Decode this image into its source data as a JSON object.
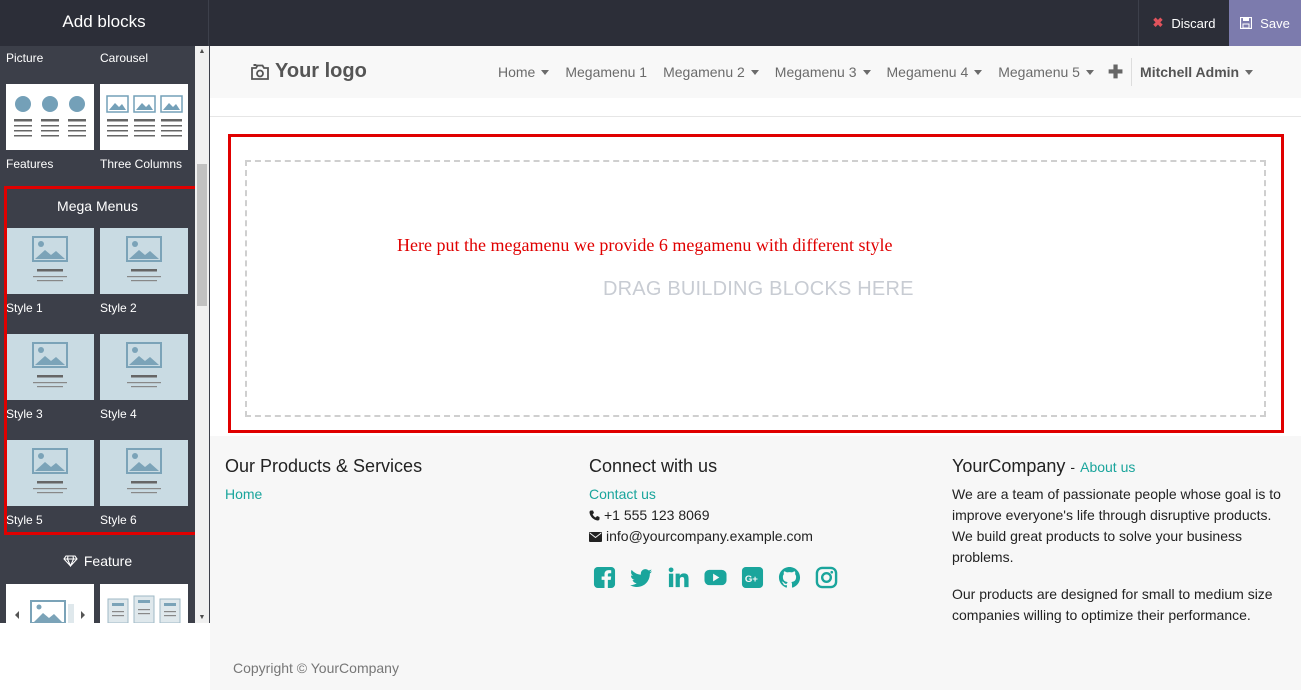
{
  "editor": {
    "panel_title": "Add blocks",
    "discard_label": "Discard",
    "save_label": "Save",
    "save_color": "#7c7bad"
  },
  "sidebar": {
    "top_labels": [
      "Picture",
      "Carousel"
    ],
    "row_labels": [
      "Features",
      "Three Columns"
    ],
    "mega_title": "Mega Menus",
    "styles": [
      "Style 1",
      "Style 2",
      "Style 3",
      "Style 4",
      "Style 5",
      "Style 6"
    ],
    "feature_title": "Feature",
    "feature_icon": "diamond-icon"
  },
  "site": {
    "logo_text": "Your logo",
    "nav": [
      {
        "label": "Home",
        "dropdown": true
      },
      {
        "label": "Megamenu 1",
        "dropdown": false
      },
      {
        "label": "Megamenu 2",
        "dropdown": true
      },
      {
        "label": "Megamenu 3",
        "dropdown": true
      },
      {
        "label": "Megamenu 4",
        "dropdown": true
      },
      {
        "label": "Megamenu 5",
        "dropdown": true
      }
    ],
    "admin": "Mitchell Admin",
    "annotation": "Here put the megamenu we provide 6 megamenu with different style",
    "drop_hint": "DRAG BUILDING BLOCKS HERE"
  },
  "footer": {
    "col1_title": "Our Products & Services",
    "col1_link": "Home",
    "col2_title": "Connect with us",
    "col2_link": "Contact us",
    "phone": "+1 555 123 8069",
    "email": "info@yourcompany.example.com",
    "col3_title": "YourCompany",
    "col3_sep": "-",
    "col3_link": "About us",
    "about_p1_lines": [
      "We are a team of passionate people whose goal is to",
      "improve everyone's life through disruptive products.",
      "We build great products to solve your business",
      "problems."
    ],
    "about_p2_lines": [
      "Our products are designed for small to medium size",
      "companies willing to optimize their performance."
    ],
    "copyright": "Copyright © YourCompany",
    "social_icons": [
      "facebook-icon",
      "twitter-icon",
      "linkedin-icon",
      "youtube-icon",
      "google-plus-icon",
      "github-icon",
      "instagram-icon"
    ],
    "accent_color": "#1aa59c"
  }
}
